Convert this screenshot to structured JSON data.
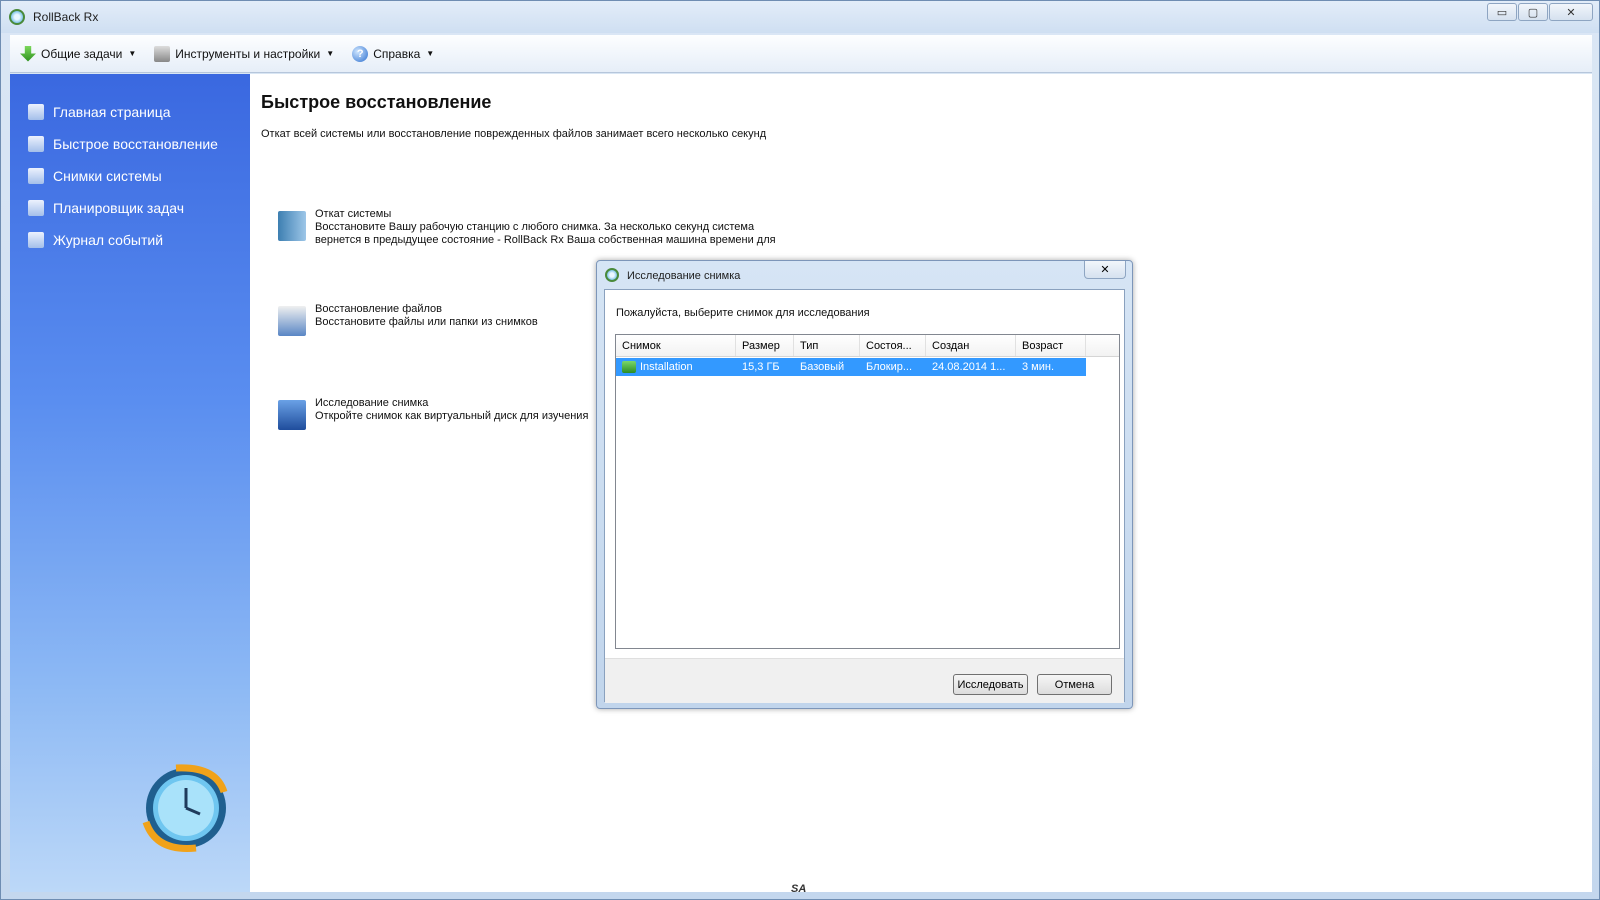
{
  "window": {
    "title": "RollBack Rx",
    "minimize": "▭",
    "maximize": "▢",
    "close": "✕"
  },
  "toolbar": {
    "items": [
      {
        "label": "Общие задачи",
        "icon": "download-arrow-icon"
      },
      {
        "label": "Инструменты и настройки",
        "icon": "tools-icon"
      },
      {
        "label": "Справка",
        "icon": "help-icon"
      }
    ],
    "help_glyph": "?"
  },
  "sidebar": {
    "items": [
      {
        "label": "Главная страница",
        "icon": "home-icon"
      },
      {
        "label": "Быстрое восстановление",
        "icon": "quick-restore-icon"
      },
      {
        "label": "Снимки системы",
        "icon": "snapshots-icon"
      },
      {
        "label": "Планировщик задач",
        "icon": "scheduler-icon"
      },
      {
        "label": "Журнал событий",
        "icon": "event-log-icon"
      }
    ]
  },
  "main": {
    "title": "Быстрое восстановление",
    "subtitle": "Откат всей системы или восстановление поврежденных файлов занимает всего несколько секунд",
    "options": [
      {
        "title": "Откат системы",
        "line1": "Восстановите Вашу рабочую станцию с любого снимка. За несколько секунд система",
        "line2": "вернется в предыдущее состояние - RollBack Rx Ваша собственная машина времени для"
      },
      {
        "title": "Восстановление файлов",
        "line1": "Восстановите файлы или папки из снимков",
        "line2": ""
      },
      {
        "title": "Исследование снимка",
        "line1": "Откройте снимок как виртуальный диск для изучения",
        "line2": ""
      }
    ]
  },
  "dialog": {
    "title": "Исследование снимка",
    "close": "✕",
    "prompt": "Пожалуйста, выберите снимок для исследования",
    "columns": [
      "Снимок",
      "Размер",
      "Тип",
      "Состоя...",
      "Создан",
      "Возраст"
    ],
    "rows": [
      {
        "name": "Installation",
        "size": "15,3 ГБ",
        "type": "Базовый",
        "state": "Блокир...",
        "created": "24.08.2014 1...",
        "age": "3 мин."
      }
    ],
    "explore_button": "Исследовать",
    "cancel_button": "Отмена"
  },
  "watermark": "SA",
  "colors": {
    "sidebar_top": "#3a68e0",
    "selection": "#3399ff",
    "accent": "#4a8a3a"
  }
}
